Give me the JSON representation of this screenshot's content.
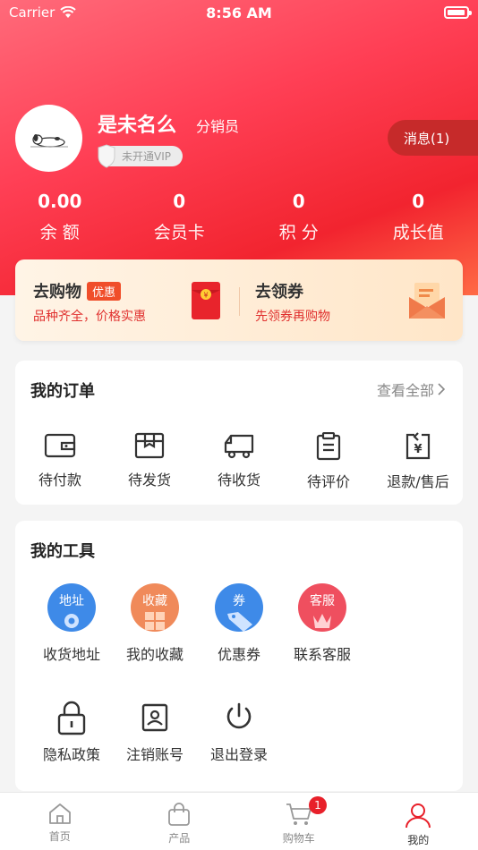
{
  "status_bar": {
    "carrier": "Carrier",
    "time": "8:56 AM"
  },
  "profile": {
    "username": "是未名么",
    "role": "分销员",
    "vip_status": "未开通VIP",
    "message_button": "消息(1)"
  },
  "stats": [
    {
      "value": "0.00",
      "label": "余 额"
    },
    {
      "value": "0",
      "label": "会员卡"
    },
    {
      "value": "0",
      "label": "积 分"
    },
    {
      "value": "0",
      "label": "成长值"
    }
  ],
  "promo": {
    "shop_title": "去购物",
    "shop_tag": "优惠",
    "shop_sub": "品种齐全，价格实惠",
    "coupon_title": "去领券",
    "coupon_sub": "先领券再购物"
  },
  "orders": {
    "title": "我的订单",
    "view_all": "查看全部",
    "items": [
      {
        "label": "待付款",
        "icon": "wallet-icon"
      },
      {
        "label": "待发货",
        "icon": "package-icon"
      },
      {
        "label": "待收货",
        "icon": "truck-icon"
      },
      {
        "label": "待评价",
        "icon": "clipboard-icon"
      },
      {
        "label": "退款/售后",
        "icon": "refund-icon"
      }
    ]
  },
  "tools": {
    "title": "我的工具",
    "items": [
      {
        "label": "收货地址",
        "badge": "地址",
        "color": "#3e8ae8",
        "icon": "location-icon"
      },
      {
        "label": "我的收藏",
        "badge": "收藏",
        "color": "#f08a5a",
        "icon": "favorites-icon"
      },
      {
        "label": "优惠券",
        "badge": "券",
        "color": "#3e8ae8",
        "icon": "coupon-tag-icon"
      },
      {
        "label": "联系客服",
        "badge": "客服",
        "color": "#ef4f5f",
        "icon": "customer-service-icon"
      },
      {
        "label": "隐私政策",
        "icon": "lock-icon"
      },
      {
        "label": "注销账号",
        "icon": "account-card-icon"
      },
      {
        "label": "退出登录",
        "icon": "power-icon"
      }
    ]
  },
  "tabbar": {
    "items": [
      {
        "label": "首页",
        "icon": "home-icon"
      },
      {
        "label": "产品",
        "icon": "bag-icon"
      },
      {
        "label": "购物车",
        "icon": "cart-icon",
        "badge": "1"
      },
      {
        "label": "我的",
        "icon": "user-icon",
        "active": true
      }
    ]
  },
  "colors": {
    "primary_red": "#f2242f",
    "accent_orange": "#f04e2a"
  }
}
